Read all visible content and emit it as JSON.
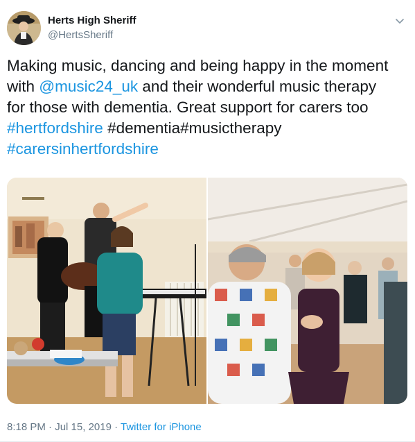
{
  "author": {
    "display_name": "Herts High Sheriff",
    "handle": "@HertsSheriff",
    "avatar_icon": "avatar-photo"
  },
  "tweet": {
    "line1": "Making music, dancing and being happy in the moment",
    "line2_pre": "with ",
    "mention": "@music24_uk",
    "line2_post": " and their wonderful music therapy",
    "line3": "for those with dementia. Great support for carers too",
    "hashtag1": "#hertfordshire",
    "line4_post": " #dementia#musictherapy",
    "hashtag2": "#carersinhertfordshire"
  },
  "meta": {
    "time": "8:18 PM",
    "separator": " · ",
    "date": "Jul 15, 2019",
    "separator2": " · ",
    "source": "Twitter for iPhone"
  },
  "colors": {
    "link": "#1b95e0",
    "text": "#14171a",
    "secondary": "#657786"
  },
  "icons": {
    "menu": "chevron-down-icon"
  }
}
